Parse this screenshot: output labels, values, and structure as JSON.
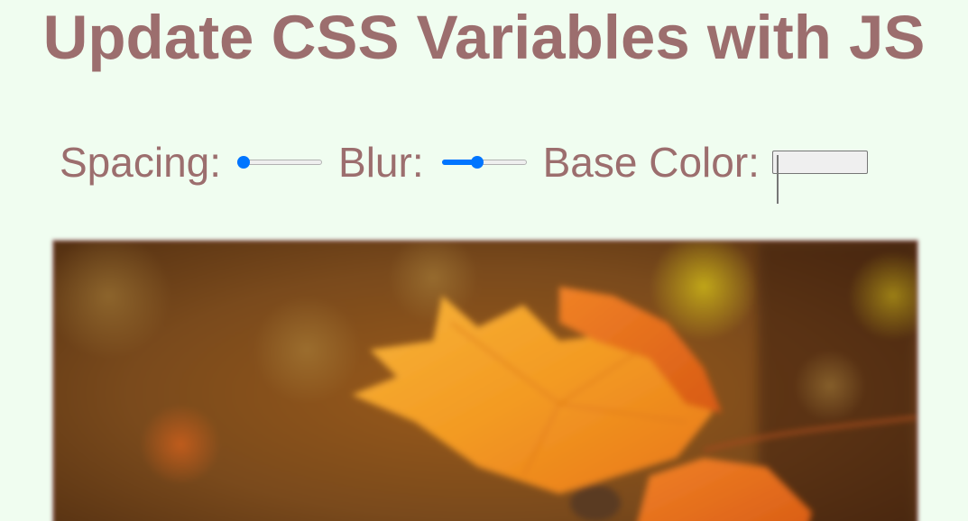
{
  "page": {
    "title": "Update CSS Variables with JS"
  },
  "controls": {
    "spacing": {
      "label": "Spacing:",
      "value": 10,
      "min": 10,
      "max": 200
    },
    "blur": {
      "label": "Blur:",
      "value": 10,
      "min": 0,
      "max": 25
    },
    "base_color": {
      "label": "Base Color:",
      "value": "#9c6e6e"
    }
  },
  "colors": {
    "background": "#f0fdf0",
    "base": "#9c6e6e",
    "slider_accent": "#0075ff"
  },
  "image": {
    "subject": "blurred autumn maple leaf photo"
  }
}
